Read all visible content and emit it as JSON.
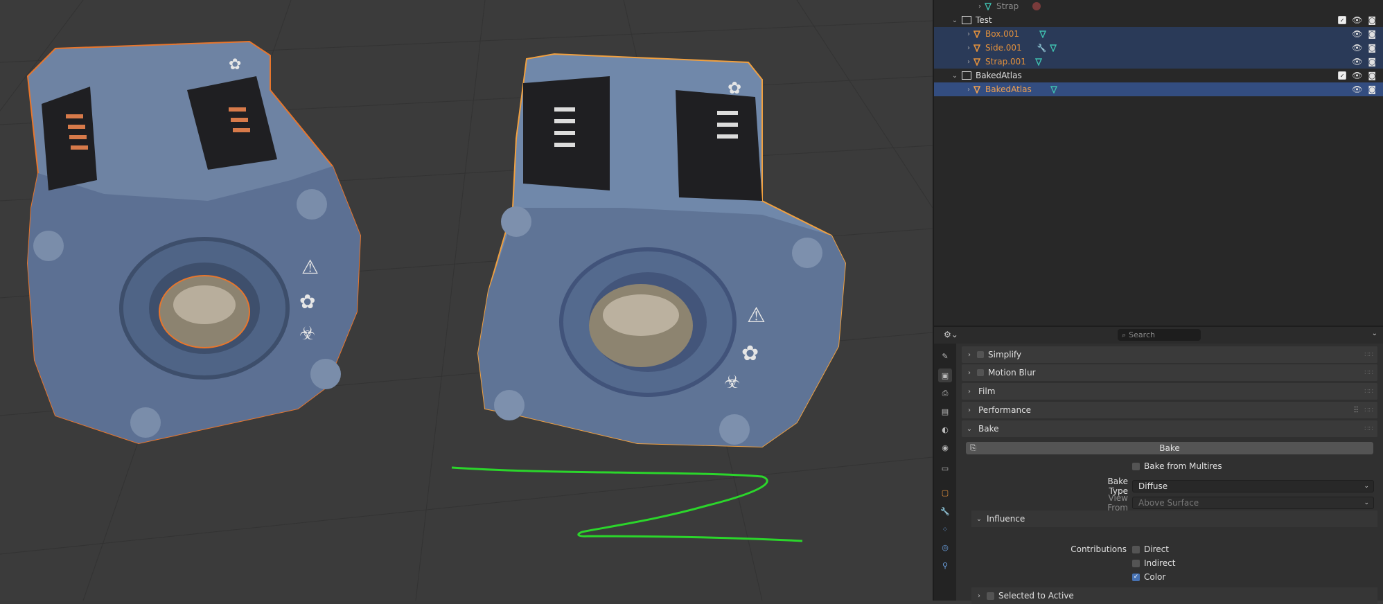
{
  "outliner": {
    "rows": [
      {
        "label": "Strap"
      },
      {
        "label": "Test"
      },
      {
        "label": "Box.001"
      },
      {
        "label": "Side.001"
      },
      {
        "label": "Strap.001"
      },
      {
        "label": "BakedAtlas"
      },
      {
        "label": "BakedAtlas"
      }
    ]
  },
  "properties": {
    "search_placeholder": "Search",
    "panels": {
      "simplify": "Simplify",
      "motion_blur": "Motion Blur",
      "film": "Film",
      "performance": "Performance",
      "bake": "Bake"
    },
    "bake_button": "Bake",
    "bake_from_multires": "Bake from Multires",
    "bake_type_label": "Bake Type",
    "bake_type_value": "Diffuse",
    "view_from_label": "View From",
    "view_from_value": "Above Surface",
    "influence": "Influence",
    "contributions_label": "Contributions",
    "contrib_direct": "Direct",
    "contrib_indirect": "Indirect",
    "contrib_color": "Color",
    "contrib_color_checked": true,
    "selected_to_active": "Selected to Active"
  },
  "colors": {
    "selection_outline": "#e8762c",
    "active_outline": "#f0a040",
    "annotation": "#2bd62b",
    "selected_row": "#2a3a58",
    "active_row": "#334d80"
  }
}
